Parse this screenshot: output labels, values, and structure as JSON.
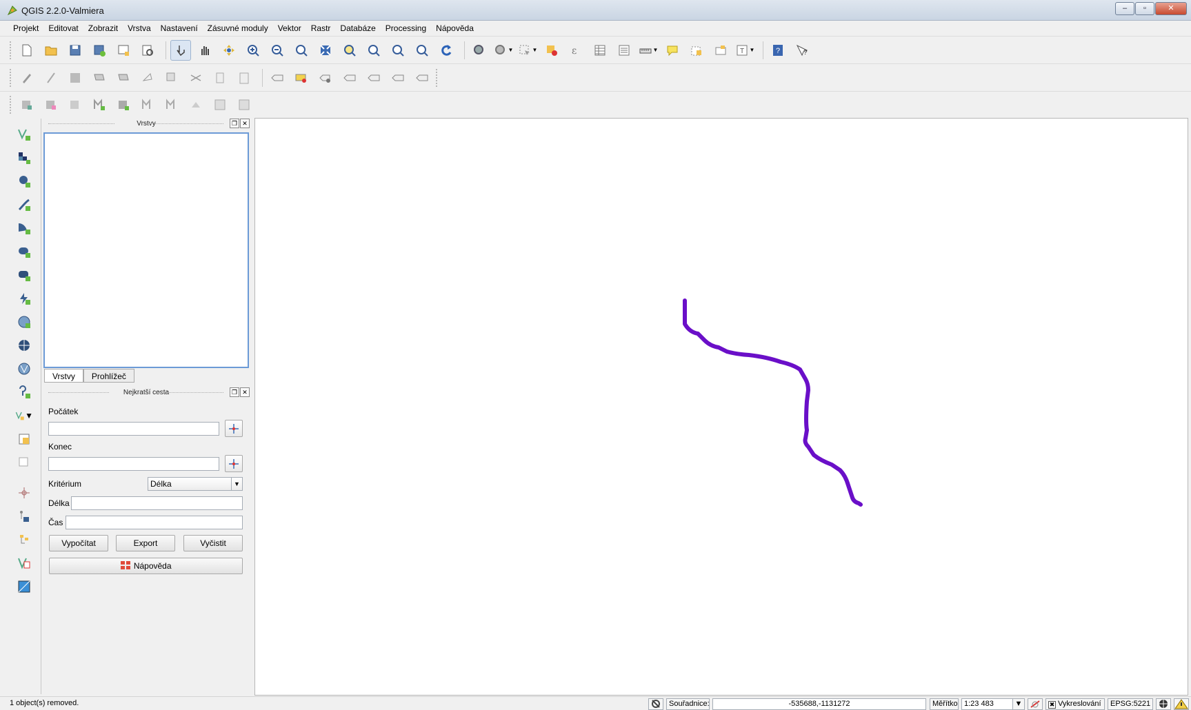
{
  "window": {
    "title": "QGIS 2.2.0-Valmiera",
    "minimize": "–",
    "maximize": "▫",
    "close": "✕"
  },
  "menu": [
    "Projekt",
    "Editovat",
    "Zobrazit",
    "Vrstva",
    "Nastavení",
    "Zásuvné moduly",
    "Vektor",
    "Rastr",
    "Databáze",
    "Processing",
    "Nápověda"
  ],
  "toolbar1_icons": [
    "new-project-icon",
    "open-project-icon",
    "save-project-icon",
    "save-as-icon",
    "new-print-composer-icon",
    "composer-manager-icon",
    "touch-zoom-icon",
    "pan-icon",
    "pan-to-selection-icon",
    "zoom-in-icon",
    "zoom-out-icon",
    "zoom-native-icon",
    "zoom-full-icon",
    "zoom-to-selection-icon",
    "zoom-to-layer-icon",
    "zoom-last-icon",
    "zoom-next-icon",
    "refresh-icon",
    "identify-icon",
    "query-icon",
    "select-icon",
    "deselect-icon",
    "field-calculator-icon",
    "attribute-table-icon",
    "statistics-icon",
    "measure-icon",
    "map-tips-icon",
    "new-bookmark-icon",
    "show-bookmarks-icon",
    "text-annotation-icon",
    "help-icon",
    "whats-this-icon"
  ],
  "toolbar2_icons": [
    "current-edits-icon",
    "toggle-editing-icon",
    "save-edits-icon",
    "add-feature-icon",
    "move-feature-icon",
    "node-tool-icon",
    "delete-selected-icon",
    "cut-features-icon",
    "copy-features-icon",
    "paste-features-icon",
    "label-icon",
    "pin-labels-icon",
    "show-hide-labels-icon",
    "move-label-icon",
    "rotate-label-icon",
    "change-label-icon",
    "label-text-icon"
  ],
  "toolbar3_icons": [
    "db1-icon",
    "db2-icon",
    "db3-icon",
    "db4-icon",
    "db5-icon",
    "db6-icon",
    "db7-icon",
    "db8-icon",
    "db9-icon",
    "db10-icon"
  ],
  "layers_panel": {
    "title": "Vrstvy",
    "tabs": [
      "Vrstvy",
      "Prohlížeč"
    ]
  },
  "shortest_path": {
    "title": "Nejkratší cesta",
    "start_label": "Počátek",
    "start_value": "",
    "end_label": "Konec",
    "end_value": "",
    "criterion_label": "Kritérium",
    "criterion_value": "Délka",
    "length_label": "Délka",
    "length_value": "",
    "time_label": "Čas",
    "time_value": "",
    "buttons": {
      "calculate": "Vypočítat",
      "export": "Export",
      "clear": "Vyčistit",
      "help": "Nápověda"
    }
  },
  "map": {
    "line_color": "#6a0fc8"
  },
  "status": {
    "message": "1 object(s) removed.",
    "coords_label": "Souřadnice:",
    "coords_value": "-535688,-1131272",
    "scale_label": "Měřítko",
    "scale_value": "1:23 483",
    "render_label": "Vykreslování",
    "epsg": "EPSG:5221"
  }
}
